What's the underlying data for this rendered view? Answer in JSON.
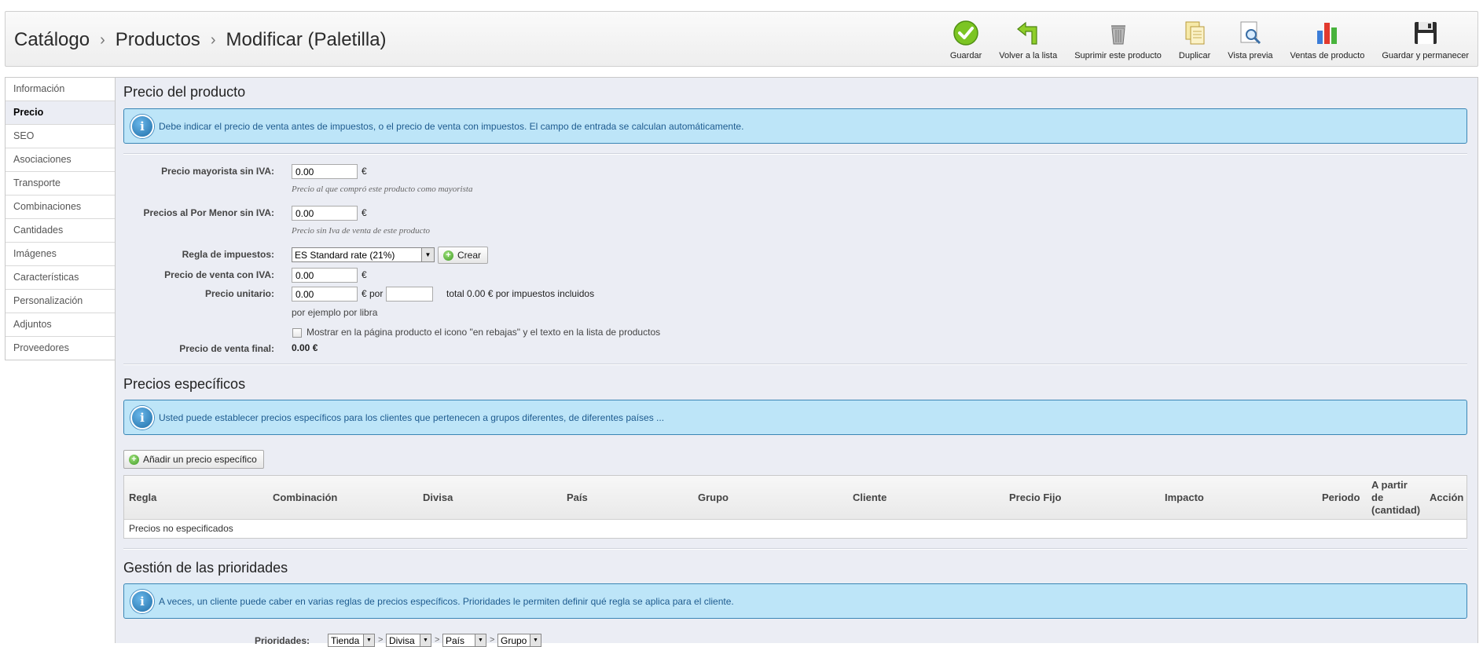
{
  "breadcrumb": [
    "Catálogo",
    "Productos",
    "Modificar (Paletilla)"
  ],
  "breadcrumb_separator": "›",
  "toolbar": [
    {
      "label": "Guardar",
      "icon": "save-check-icon"
    },
    {
      "label": "Volver a la lista",
      "icon": "back-arrow-icon"
    },
    {
      "label": "Suprimir este producto",
      "icon": "trash-icon"
    },
    {
      "label": "Duplicar",
      "icon": "duplicate-icon"
    },
    {
      "label": "Vista previa",
      "icon": "preview-magnifier-icon"
    },
    {
      "label": "Ventas de producto",
      "icon": "sales-chart-icon"
    },
    {
      "label": "Guardar y permanecer",
      "icon": "floppy-disk-icon"
    }
  ],
  "sidebar": {
    "items": [
      {
        "label": "Información"
      },
      {
        "label": "Precio",
        "active": true
      },
      {
        "label": "SEO"
      },
      {
        "label": "Asociaciones"
      },
      {
        "label": "Transporte"
      },
      {
        "label": "Combinaciones"
      },
      {
        "label": "Cantidades"
      },
      {
        "label": "Imágenes"
      },
      {
        "label": "Características"
      },
      {
        "label": "Personalización"
      },
      {
        "label": "Adjuntos"
      },
      {
        "label": "Proveedores"
      }
    ]
  },
  "price": {
    "title": "Precio del producto",
    "hint": "Debe indicar el precio de venta antes de impuestos, o el precio de venta con impuestos. El campo de entrada se calculan automáticamente.",
    "wholesale_label": "Precio mayorista sin IVA:",
    "wholesale_value": "0.00",
    "wholesale_help": "Precio al que compró este producto como mayorista",
    "retail_label": "Precios al Por Menor sin IVA:",
    "retail_value": "0.00",
    "retail_help": "Precio sin Iva de venta de este producto",
    "currency": "€",
    "tax_label": "Regla de impuestos:",
    "tax_value": "ES Standard rate (21%)",
    "create_label": "Crear",
    "with_tax_label": "Precio de venta con IVA:",
    "with_tax_value": "0.00",
    "unit_label": "Precio unitario:",
    "unit_value": "0.00",
    "unit_per": "€ por",
    "unit_per_value": "",
    "unit_total": "total 0.00 € por impuestos incluidos",
    "unit_example": "por ejemplo por libra",
    "on_sale_label": "Mostrar en la página producto el icono \"en rebajas\" y el texto en la lista de productos",
    "final_label": "Precio de venta final:",
    "final_value": "0.00 €"
  },
  "specific": {
    "title": "Precios específicos",
    "hint": "Usted puede establecer precios específicos para los clientes que pertenecen a grupos diferentes, de diferentes países ...",
    "add_button": "Añadir un precio específico",
    "columns": [
      "Regla",
      "Combinación",
      "Divisa",
      "País",
      "Grupo",
      "Cliente",
      "Precio Fijo",
      "Impacto",
      "Periodo"
    ],
    "qty_column": [
      "A partir",
      "de",
      "(cantidad)"
    ],
    "action_column": "Acción",
    "empty": "Precios no especificados"
  },
  "priorities": {
    "title": "Gestión de las prioridades",
    "hint": "A veces, un cliente puede caber en varias reglas de precios específicos. Prioridades le permiten definir qué regla se aplica para el cliente.",
    "label": "Prioridades:",
    "separator": ">",
    "values": [
      "Tienda",
      "Divisa",
      "País",
      "Grupo"
    ]
  }
}
